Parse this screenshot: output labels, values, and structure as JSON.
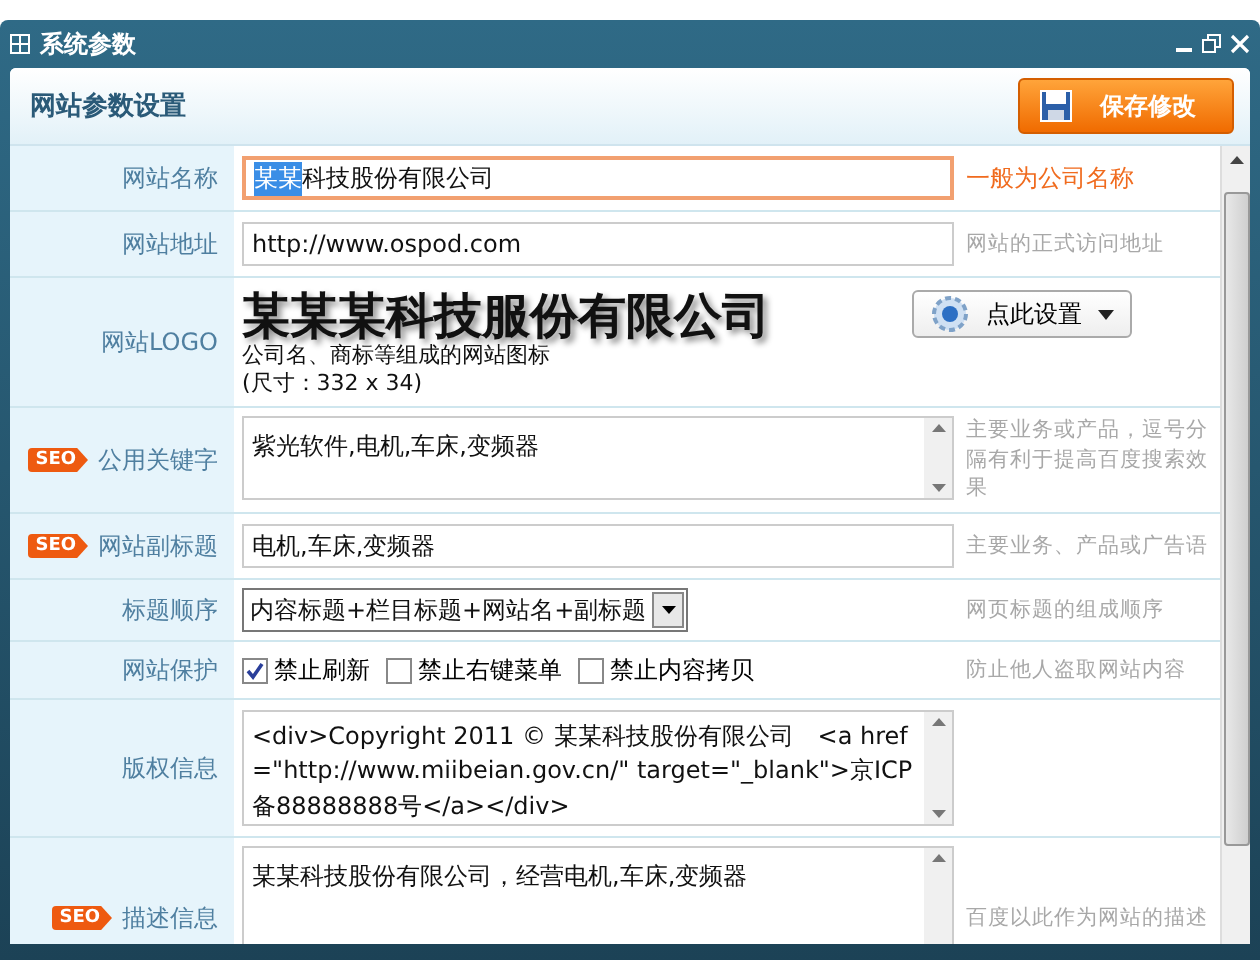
{
  "window": {
    "title": "系统参数"
  },
  "header": {
    "title": "网站参数设置",
    "save_button": "保存修改"
  },
  "rows": [
    {
      "kind": "text",
      "label": "网站名称",
      "focused": true,
      "value_parts": [
        {
          "text": "某某",
          "selected": true
        },
        {
          "text": "科技股份有限公司",
          "selected": false
        }
      ],
      "hint": "一般为公司名称",
      "hint_emphasis": true
    },
    {
      "kind": "text",
      "label": "网站地址",
      "focused": false,
      "value_parts": [
        {
          "text": "http://www.ospod.com",
          "selected": false
        }
      ],
      "hint": "网站的正式访问地址",
      "hint_emphasis": false
    },
    {
      "kind": "logo",
      "label": "网站LOGO",
      "logo_text": "某某某科技服份有限公司",
      "caption": "公司名、商标等组成的网站图标",
      "size_note": "(尺寸：332 x 34)",
      "button": "点此设置"
    },
    {
      "kind": "textarea",
      "label": "公用关键字",
      "badge": "SEO",
      "value": "紫光软件,电机,车床,变频器",
      "hint": "主要业务或产品，逗号分隔有利于提高百度搜索效果",
      "hint_emphasis": false
    },
    {
      "kind": "text",
      "label": "网站副标题",
      "badge": "SEO",
      "focused": false,
      "value_parts": [
        {
          "text": "电机,车床,变频器",
          "selected": false
        }
      ],
      "hint": "主要业务、产品或广告语",
      "hint_emphasis": false
    },
    {
      "kind": "select",
      "label": "标题顺序",
      "value": "内容标题+栏目标题+网站名+副标题",
      "hint": "网页标题的组成顺序",
      "hint_emphasis": false
    },
    {
      "kind": "checkboxes",
      "label": "网站保护",
      "options": [
        {
          "label": "禁止刷新",
          "checked": true
        },
        {
          "label": "禁止右键菜单",
          "checked": false
        },
        {
          "label": "禁止内容拷贝",
          "checked": false
        }
      ],
      "hint": "防止他人盗取网站内容",
      "hint_emphasis": false
    },
    {
      "kind": "code",
      "label": "版权信息",
      "value": "<div>Copyright 2011 © 某某科技股份有限公司　<a href=\"http://www.miibeian.gov.cn/\" target=\"_blank\">京ICP备88888888号</a></div>"
    },
    {
      "kind": "textarea_tall",
      "label": "描述信息",
      "badge": "SEO",
      "value": "某某科技股份有限公司，经营电机,车床,变频器",
      "hint": "百度以此作为网站的描述",
      "hint_emphasis": false
    }
  ]
}
